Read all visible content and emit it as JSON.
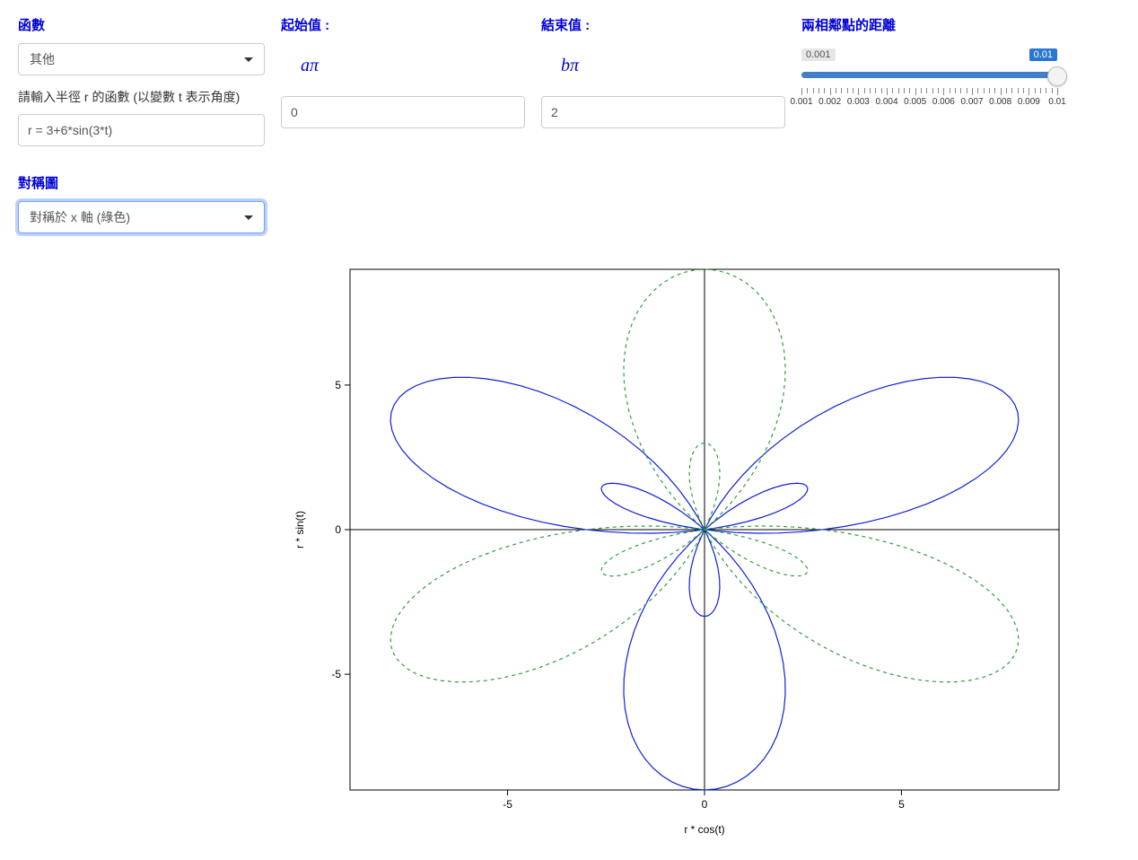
{
  "labels": {
    "function": "函數",
    "start": "起始值 :",
    "end": "結束值 :",
    "distance": "兩相鄰點的距離",
    "start_math": "aπ",
    "end_math": "bπ",
    "help_text": "請輸入半徑 r 的函數 (以變數 t 表示角度)",
    "symmetry": "對稱圖"
  },
  "controls": {
    "function_select": "其他",
    "formula": "r = 3+6*sin(3*t)",
    "symmetry_select": "對稱於 x 軸 (綠色)",
    "start_value": "0",
    "end_value": "2",
    "slider_min_label": "0.001",
    "slider_max_label": "0.01",
    "slider_value": 0.01,
    "slider_min": 0.001,
    "slider_max": 0.01,
    "slider_ticks": [
      "0.001",
      "0.002",
      "0.003",
      "0.004",
      "0.005",
      "0.006",
      "0.007",
      "0.008",
      "0.009",
      "0.01"
    ]
  },
  "chart_data": {
    "type": "line",
    "title": "",
    "xlabel": "r * cos(t)",
    "ylabel": "r * sin(t)",
    "xlim": [
      -9,
      9
    ],
    "ylim": [
      -9,
      9
    ],
    "x_ticks": [
      -5,
      0,
      5
    ],
    "y_ticks": [
      -5,
      0,
      5
    ],
    "t_range": [
      0,
      "2π"
    ],
    "step": 0.01,
    "series": [
      {
        "name": "r = 3+6*sin(3*t)",
        "style": "solid",
        "color": "#1020d8",
        "polar": "3+6*sin(3*t)"
      },
      {
        "name": "對稱於 x 軸",
        "style": "dashed",
        "color": "#2e9e3f",
        "polar": "-(3+6*sin(3*t))"
      }
    ]
  }
}
